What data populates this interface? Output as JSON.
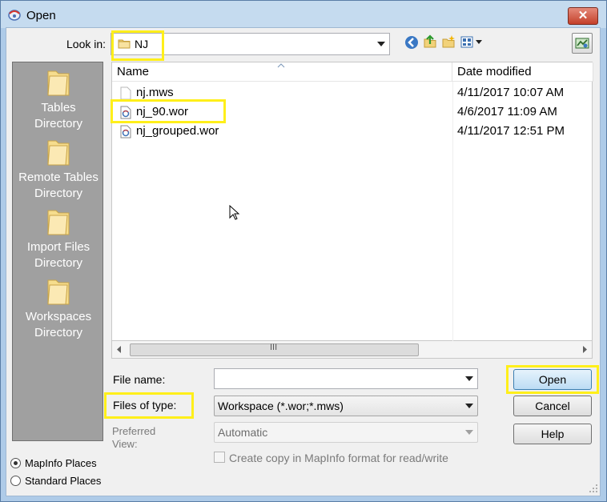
{
  "window": {
    "title": "Open",
    "close_label": "✕"
  },
  "lookin": {
    "label": "Look in:",
    "value": "NJ"
  },
  "places": [
    {
      "label": "Tables Directory"
    },
    {
      "label": "Remote Tables Directory"
    },
    {
      "label": "Import Files Directory"
    },
    {
      "label": "Workspaces Directory"
    }
  ],
  "filelist": {
    "columns": {
      "name": "Name",
      "date": "Date modified"
    },
    "rows": [
      {
        "name": "nj.mws",
        "date": "4/11/2017 10:07 AM"
      },
      {
        "name": "nj_90.wor",
        "date": "4/6/2017 11:09 AM"
      },
      {
        "name": "nj_grouped.wor",
        "date": "4/11/2017 12:51 PM"
      }
    ],
    "scroll_grip": "III"
  },
  "form": {
    "filename_label": "File name:",
    "filename_value": "",
    "filetype_label": "Files of type:",
    "filetype_value": "Workspace (*.wor;*.mws)",
    "preferred_label_1": "Preferred",
    "preferred_label_2": "View:",
    "preferred_value": "Automatic",
    "copy_label": "Create copy in MapInfo format for read/write"
  },
  "buttons": {
    "open": "Open",
    "cancel": "Cancel",
    "help": "Help"
  },
  "radios": {
    "mapinfo": "MapInfo Places",
    "standard": "Standard Places",
    "selected": "mapinfo"
  },
  "colors": {
    "highlight": "#ffef1a",
    "places_bg": "#a0a0a0",
    "close_red": "#c4402a"
  }
}
